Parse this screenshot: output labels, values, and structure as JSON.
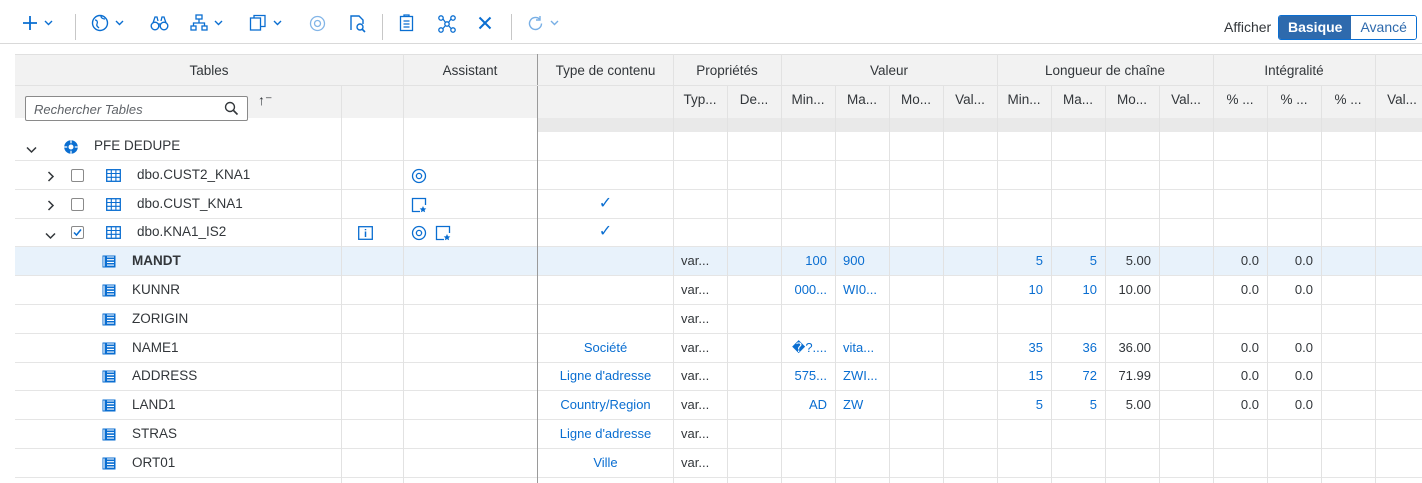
{
  "toolbar": {
    "items": [
      "add-icon",
      "globe-icon",
      "binoculars-icon",
      "hierarchy-icon",
      "copy-icon",
      "settings-icon",
      "edit-search-icon",
      "clipboard-icon",
      "workflow-icon",
      "close-icon",
      "refresh-icon"
    ],
    "afficher_label": "Afficher",
    "view_basic": "Basique",
    "view_advanced": "Avancé",
    "accent": "#0a6ed1"
  },
  "header": {
    "tables": "Tables",
    "search_placeholder": "Rechercher Tables",
    "assistant": "Assistant",
    "content_type": "Type de contenu",
    "properties": "Propriétés",
    "value": "Valeur",
    "string_length": "Longueur de chaîne",
    "completeness": "Intégralité",
    "sub": [
      "Typ...",
      "De...",
      "Min...",
      "Ma...",
      "Mo...",
      "Val...",
      "Min...",
      "Ma...",
      "Mo...",
      "Val...",
      "% ...",
      "% ...",
      "% ...",
      "Val..."
    ]
  },
  "tree": {
    "root": "PFE DEDUPE",
    "tables": [
      {
        "name": "dbo.CUST2_KNA1",
        "checked": false,
        "expanded": false,
        "check": ""
      },
      {
        "name": "dbo.CUST_KNA1",
        "checked": false,
        "expanded": false,
        "check": "✓"
      },
      {
        "name": "dbo.KNA1_IS2",
        "checked": true,
        "expanded": true,
        "check": "✓"
      }
    ]
  },
  "columns": [
    {
      "name": "MANDT",
      "ctype": "",
      "typ": "var...",
      "vmin": "100",
      "vmax": "900",
      "lmin": "5",
      "lmax": "5",
      "lmoy": "5.00",
      "c1": "0.0",
      "c2": "0.0"
    },
    {
      "name": "KUNNR",
      "ctype": "",
      "typ": "var...",
      "vmin": "000...",
      "vmax": "WI0...",
      "lmin": "10",
      "lmax": "10",
      "lmoy": "10.00",
      "c1": "0.0",
      "c2": "0.0"
    },
    {
      "name": "ZORIGIN",
      "ctype": "",
      "typ": "var...",
      "vmin": "",
      "vmax": "",
      "lmin": "",
      "lmax": "",
      "lmoy": "",
      "c1": "",
      "c2": ""
    },
    {
      "name": "NAME1",
      "ctype": "Société",
      "typ": "var...",
      "vmin": "�?....",
      "vmax": "vita...",
      "lmin": "35",
      "lmax": "36",
      "lmoy": "36.00",
      "c1": "0.0",
      "c2": "0.0"
    },
    {
      "name": "ADDRESS",
      "ctype": "Ligne d'adresse",
      "typ": "var...",
      "vmin": "575...",
      "vmax": "ZWI...",
      "lmin": "15",
      "lmax": "72",
      "lmoy": "71.99",
      "c1": "0.0",
      "c2": "0.0"
    },
    {
      "name": "LAND1",
      "ctype": "Country/Region",
      "typ": "var...",
      "vmin": "AD",
      "vmax": "ZW",
      "lmin": "5",
      "lmax": "5",
      "lmoy": "5.00",
      "c1": "0.0",
      "c2": "0.0"
    },
    {
      "name": "STRAS",
      "ctype": "Ligne d'adresse",
      "typ": "var...",
      "vmin": "",
      "vmax": "",
      "lmin": "",
      "lmax": "",
      "lmoy": "",
      "c1": "",
      "c2": ""
    },
    {
      "name": "ORT01",
      "ctype": "Ville",
      "typ": "var...",
      "vmin": "",
      "vmax": "",
      "lmin": "",
      "lmax": "",
      "lmoy": "",
      "c1": "",
      "c2": ""
    }
  ]
}
